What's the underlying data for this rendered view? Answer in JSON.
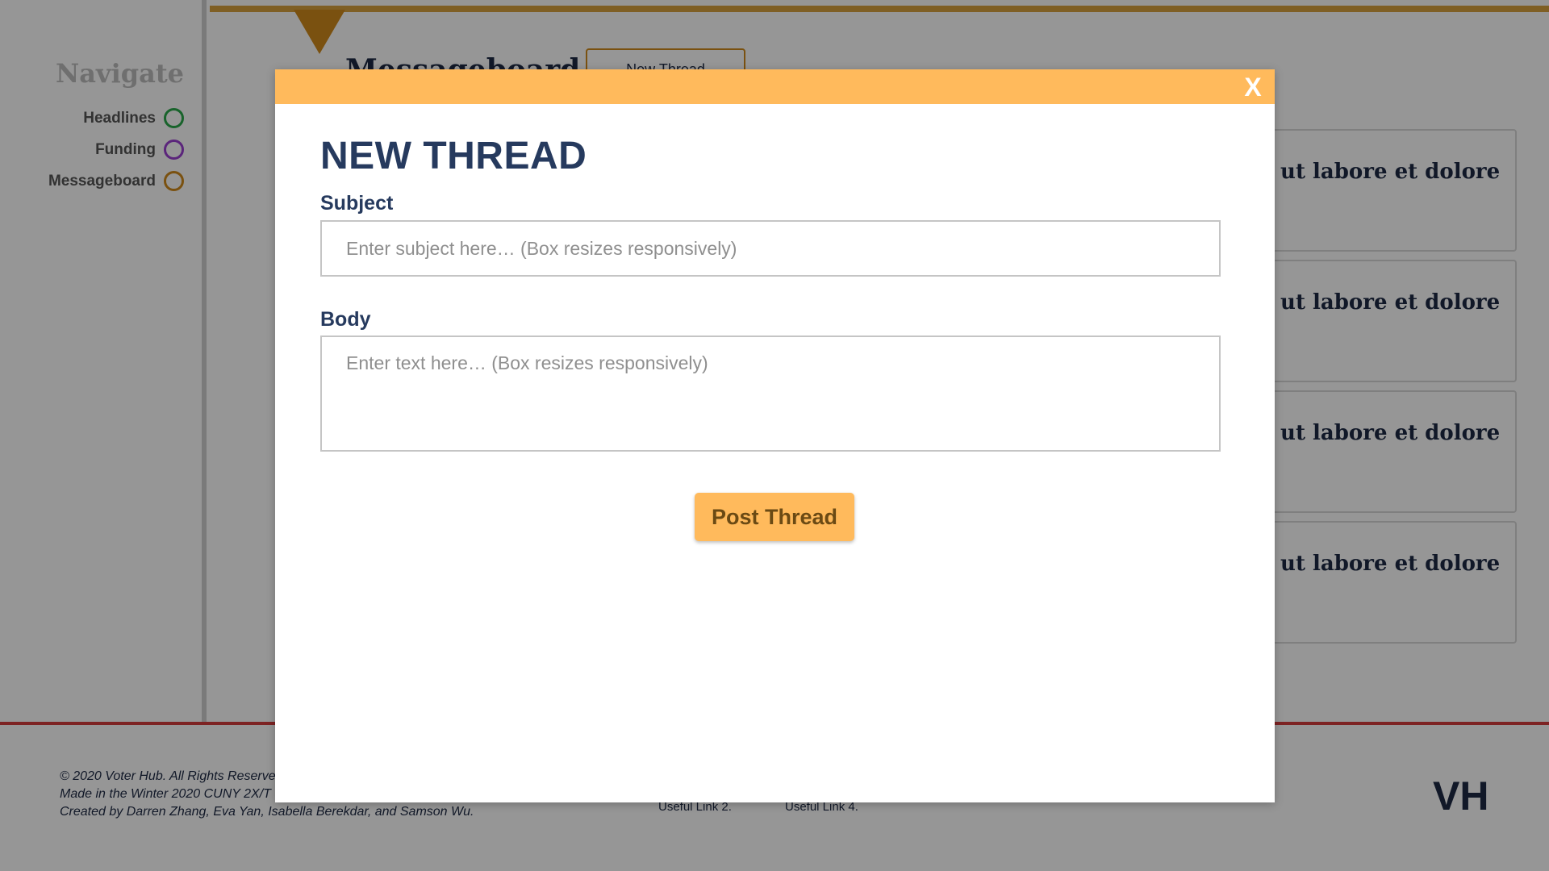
{
  "sidebar": {
    "title": "Navigate",
    "items": [
      {
        "label": "Headlines",
        "ring_color": "#2aa84a"
      },
      {
        "label": "Funding",
        "ring_color": "#9b3fd1"
      },
      {
        "label": "Messageboard",
        "ring_color": "#d08a1c"
      }
    ]
  },
  "main": {
    "title": "Messageboard",
    "new_thread_button": "New Thread",
    "threads": [
      {
        "snippet": "t ut labore et dolore"
      },
      {
        "snippet": "t ut labore et dolore"
      },
      {
        "snippet": "t ut labore et dolore"
      },
      {
        "snippet": "t ut labore et dolore"
      }
    ]
  },
  "footer": {
    "copyright": "© 2020 Voter Hub. All Rights Reserve",
    "made_in": "Made in the Winter 2020 CUNY 2X/T",
    "credits": "Created by Darren Zhang, Eva Yan, Isabella Berekdar, and Samson Wu.",
    "links": [
      "Useful Link 2.",
      "Useful Link 4."
    ],
    "logo": "VH"
  },
  "modal": {
    "close_label": "X",
    "title": "NEW THREAD",
    "subject_label": "Subject",
    "subject_placeholder": "Enter subject here… (Box resizes responsively)",
    "body_label": "Body",
    "body_placeholder": "Enter text here… (Box resizes responsively)",
    "post_button": "Post Thread"
  },
  "colors": {
    "modal_header": "#ffba5c",
    "primary_text": "#263a5e",
    "accent_orange": "#d08a1c",
    "footer_rule": "#d43c3c"
  }
}
